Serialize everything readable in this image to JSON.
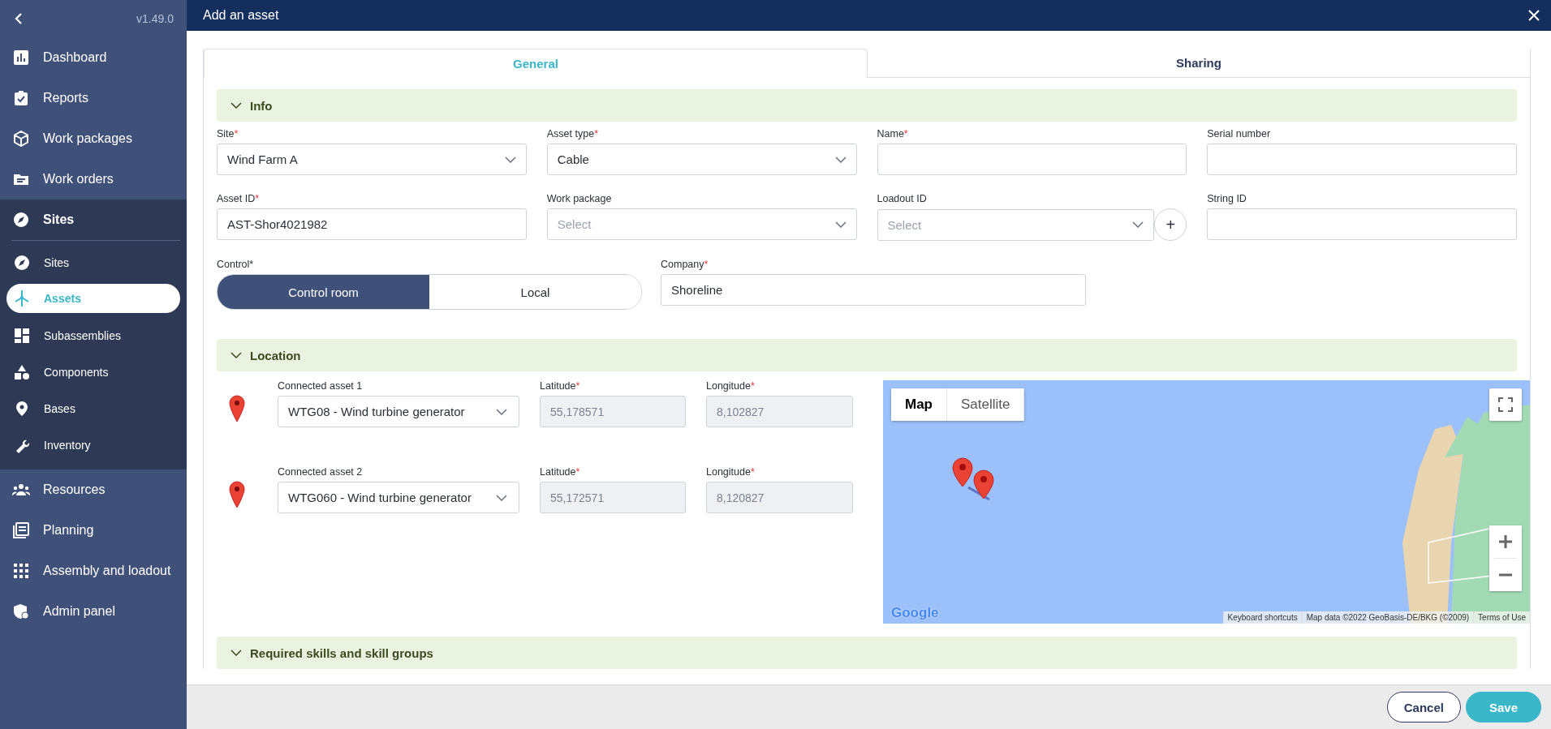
{
  "sidebar": {
    "version": "v1.49.0",
    "items": [
      {
        "label": "Dashboard",
        "selected": false
      },
      {
        "label": "Reports",
        "selected": false
      },
      {
        "label": "Work packages",
        "selected": false
      },
      {
        "label": "Work orders",
        "selected": false
      },
      {
        "label": "Sites",
        "selected": false,
        "expanded": true,
        "children": [
          {
            "label": "Sites",
            "selected": false
          },
          {
            "label": "Assets",
            "selected": true
          },
          {
            "label": "Subassemblies",
            "selected": false
          },
          {
            "label": "Components",
            "selected": false
          },
          {
            "label": "Bases",
            "selected": false
          },
          {
            "label": "Inventory",
            "selected": false
          }
        ]
      },
      {
        "label": "Resources",
        "selected": false
      },
      {
        "label": "Planning",
        "selected": false
      },
      {
        "label": "Assembly and loadout",
        "selected": false
      },
      {
        "label": "Admin panel",
        "selected": false
      }
    ]
  },
  "dialog": {
    "title": "Add an asset"
  },
  "tabs": [
    {
      "label": "General",
      "selected": true
    },
    {
      "label": "Sharing",
      "selected": false
    }
  ],
  "sections": [
    {
      "kind": "info",
      "title": "Info",
      "expanded": true,
      "fields": [
        {
          "kind": "select",
          "label": "Site",
          "required": "*",
          "value": "Wind Farm A"
        },
        {
          "kind": "select",
          "label": "Asset type",
          "required": "*",
          "value": "Cable"
        },
        {
          "kind": "input",
          "label": "Name",
          "required": "*"
        },
        {
          "kind": "input",
          "label": "Serial number"
        },
        {
          "kind": "input",
          "label": "Asset ID",
          "required": "*",
          "value": "AST-Shor4021982"
        },
        {
          "kind": "select",
          "label": "Work package",
          "placeholder": "Select"
        },
        {
          "kind": "select",
          "label": "Loadout ID",
          "placeholder": "Select",
          "add_button": "+"
        },
        {
          "kind": "input",
          "label": "String ID"
        }
      ],
      "control": {
        "label": "Control*",
        "options": [
          {
            "label": "Control room",
            "selected": true
          },
          {
            "label": "Local",
            "selected": false
          }
        ]
      },
      "company": {
        "label": "Company",
        "required": "*",
        "value": "Shoreline"
      }
    },
    {
      "kind": "location",
      "title": "Location",
      "expanded": true,
      "connected_assets": [
        {
          "label": "Connected asset 1",
          "value": "WTG08 - Wind turbine generator",
          "latitude_label": "Latitude",
          "latitude_required": "*",
          "latitude": "55,178571",
          "longitude_label": "Longitude",
          "longitude_required": "*",
          "longitude": "8,102827",
          "disabled": true
        },
        {
          "label": "Connected asset 2",
          "value": "WTG060 - Wind turbine generator",
          "latitude_label": "Latitude",
          "latitude_required": "*",
          "latitude": "55,172571",
          "longitude_label": "Longitude",
          "longitude_required": "*",
          "longitude": "8,120827",
          "disabled": true
        }
      ],
      "map": {
        "map_types": [
          {
            "label": "Map",
            "selected": true
          },
          {
            "label": "Satellite",
            "selected": false
          }
        ],
        "logo": "Google",
        "attribution": [
          "Keyboard shortcuts",
          "Map data ©2022 GeoBasis-DE/BKG (©2009)",
          "Terms of Use"
        ]
      }
    },
    {
      "kind": "skills",
      "title": "Required skills and skill groups",
      "expanded": true
    }
  ],
  "buttons": [
    {
      "label": "Cancel",
      "kind": "secondary"
    },
    {
      "label": "Save",
      "kind": "primary"
    }
  ]
}
